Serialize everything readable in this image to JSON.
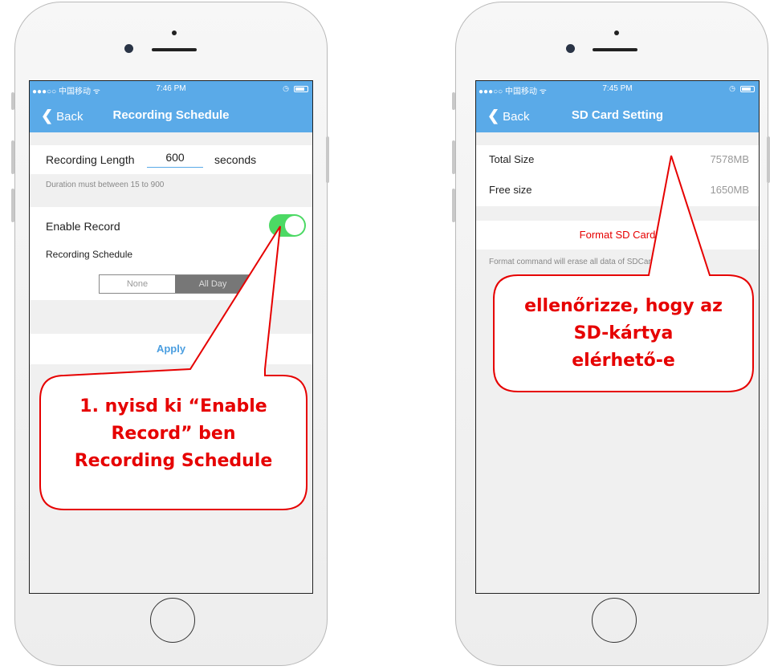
{
  "left_phone": {
    "status": {
      "carrier": "●●●○○ 中国移动 ᯤ",
      "time": "7:46 PM"
    },
    "nav": {
      "back_label": "Back",
      "title": "Recording Schedule"
    },
    "recording_length": {
      "label": "Recording Length",
      "value": "600",
      "unit": "seconds"
    },
    "duration_hint": "Duration must between 15 to 900",
    "enable_record": {
      "label": "Enable Record",
      "on": true
    },
    "schedule_label": "Recording Schedule",
    "schedule_options": [
      "None",
      "All Day"
    ],
    "schedule_selected": "All Day",
    "apply_label": "Apply",
    "annotation": [
      "1. nyisd ki “Enable",
      "Record” ben",
      "Recording Schedule"
    ]
  },
  "right_phone": {
    "status": {
      "carrier": "●●●○○ 中国移动 ᯤ",
      "time": "7:45 PM"
    },
    "nav": {
      "back_label": "Back",
      "title": "SD Card Setting"
    },
    "total_size": {
      "label": "Total Size",
      "value": "7578MB"
    },
    "free_size": {
      "label": "Free size",
      "value": "1650MB"
    },
    "format_button": "Format SD Card",
    "format_hint": "Format command will erase all data of SDCard",
    "annotation": [
      "ellenőrizze, hogy az",
      "SD-kártya",
      "elérhető-e"
    ]
  },
  "colors": {
    "nav_blue": "#5aaae8",
    "toggle_green": "#4cd964",
    "annotation_red": "#e60000",
    "apply_blue": "#4a9ee0"
  }
}
